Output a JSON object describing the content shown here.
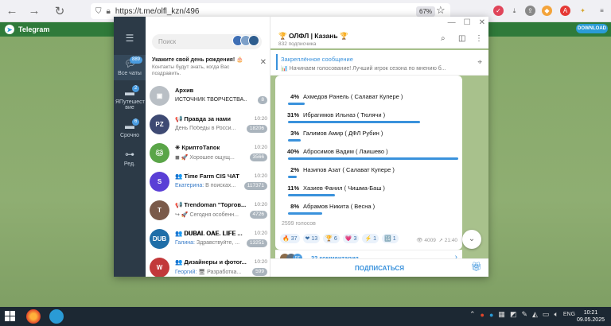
{
  "browser": {
    "url": "https://t.me/olfl_kzn/496",
    "zoom": "67%"
  },
  "telegram_header": {
    "brand": "Telegram",
    "download_label": "DOWNLOAD"
  },
  "rail": {
    "items": [
      {
        "label": "Все чаты",
        "badge": "889",
        "icon": "chat-bubbles-icon"
      },
      {
        "label": "ЯПутешествие",
        "label_short": "ЯПутешест вие",
        "badge": "2",
        "icon": "folder-icon"
      },
      {
        "label": "Срочно",
        "badge": "6",
        "icon": "folder-icon"
      },
      {
        "label": "Ред.",
        "icon": "sliders-icon"
      }
    ]
  },
  "search": {
    "placeholder": "Поиск"
  },
  "birthday_banner": {
    "title": "Укажите свой день рождения! 🎂",
    "subtitle": "Контакты будут знать, когда Вас поздравить."
  },
  "chats": [
    {
      "name": "Архив",
      "message": "ИСТОЧНИК ТВОРЧЕСТВА...",
      "time": "",
      "badge": "8",
      "color": "#b9bfc5"
    },
    {
      "name": "📢 Правда за нами",
      "message": "День Победы в Росси...",
      "time": "10:20",
      "badge": "18206",
      "color": "#3e4a73"
    },
    {
      "name": "✳ КриптоТапок",
      "message": "◼ 🚀 Хорошее ощущ...",
      "time": "10:20",
      "badge": "3566",
      "color": "#5aa548"
    },
    {
      "name": "👥 Time Farm CIS ЧАТ",
      "sender": "Екатерина:",
      "message": " В поисках...",
      "time": "10:20",
      "badge": "117371",
      "color": "#5a3fd6"
    },
    {
      "name": "📢 Trendoman \"Торгов...",
      "message": "↪ 🚀 Сегодня особенн...",
      "time": "10:20",
      "badge": "4726",
      "color": "#7a5a4a"
    },
    {
      "name": "👥 𝐃𝐔𝐁𝐀𝐈. 𝐎𝐀𝐄. 𝐋𝐈𝐅𝐄 ...",
      "sender": "Галина:",
      "message": " Здравствуйте, ...",
      "time": "10:20",
      "badge": "13251",
      "color": "#1f6ea8"
    },
    {
      "name": "👥 Дизайнеры и фотог...",
      "sender": "Георгий:",
      "message": " 🖥 Разработка...",
      "time": "10:20",
      "badge": "599",
      "color": "#c2383a"
    }
  ],
  "channel": {
    "title": "🏆 ОЛФЛ | Казань 🏆",
    "subscribers": "832 подписчика",
    "pinned_title": "Закреплённое сообщение",
    "pinned_text": "📊 Начинаем голосование! Лучший игрок сезона по мнению б..."
  },
  "poll": {
    "options": [
      {
        "pct": "4%",
        "name": "Ахмедов Ранель ( Салават  Купере )",
        "value": 4
      },
      {
        "pct": "31%",
        "name": "Ибрагимов Ильназ ( Тюлячи )",
        "value": 31
      },
      {
        "pct": "3%",
        "name": "Галимов Амир ( ДФЛ Рубин )",
        "value": 3
      },
      {
        "pct": "40%",
        "name": "Абросимов Вадим ( Лаишево )",
        "value": 40
      },
      {
        "pct": "2%",
        "name": "Назипов Азат ( Салават Купере )",
        "value": 2
      },
      {
        "pct": "11%",
        "name": "Хазиев Фанил ( Чишма-Баш )",
        "value": 11
      },
      {
        "pct": "8%",
        "name": "Абрамов Никита ( Весна )",
        "value": 8
      }
    ],
    "votes": "2599 голосов"
  },
  "reactions": [
    {
      "emoji": "🔥",
      "count": "37"
    },
    {
      "emoji": "❤",
      "count": "13"
    },
    {
      "emoji": "🏆",
      "count": "6"
    },
    {
      "emoji": "💗",
      "count": "3"
    },
    {
      "emoji": "⚡",
      "count": "1"
    },
    {
      "emoji": "🔢",
      "count": "1"
    }
  ],
  "post_meta": {
    "views": "4009",
    "time": "21:40"
  },
  "comments_label": "32 комментария",
  "subscribe_label": "ПОДПИСАТЬСЯ",
  "taskbar": {
    "lang": "ENG",
    "time": "10:21",
    "date": "09.05.2025"
  }
}
